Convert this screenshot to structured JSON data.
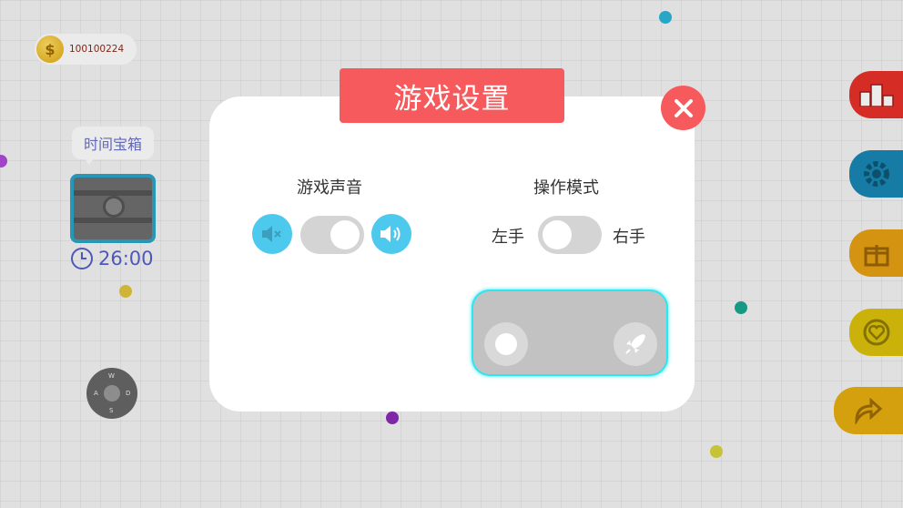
{
  "hud": {
    "coins": "100100224",
    "chest_label": "时间宝箱",
    "timer": "26:00",
    "joystick": {
      "up": "W",
      "left": "A",
      "right": "D",
      "down": "S"
    }
  },
  "side_buttons": [
    {
      "name": "leaderboard",
      "icon": "podium-icon",
      "color": "#e8312a"
    },
    {
      "name": "settings",
      "icon": "gear-icon",
      "color": "#1a87b3"
    },
    {
      "name": "gift",
      "icon": "gift-icon",
      "color": "#e6a114"
    },
    {
      "name": "favorite",
      "icon": "heart-icon",
      "color": "#ddc20d"
    },
    {
      "name": "share",
      "icon": "share-icon",
      "color": "#e8ae10"
    }
  ],
  "dialog": {
    "title": "游戏设置",
    "sound": {
      "title": "游戏声音",
      "enabled": true
    },
    "control": {
      "title": "操作模式",
      "left_label": "左手",
      "right_label": "右手",
      "mode": "left"
    }
  },
  "colors": {
    "accent": "#f65a5c",
    "sound_icon": "#4ec9ee",
    "preview_border": "#2ee6f0"
  }
}
